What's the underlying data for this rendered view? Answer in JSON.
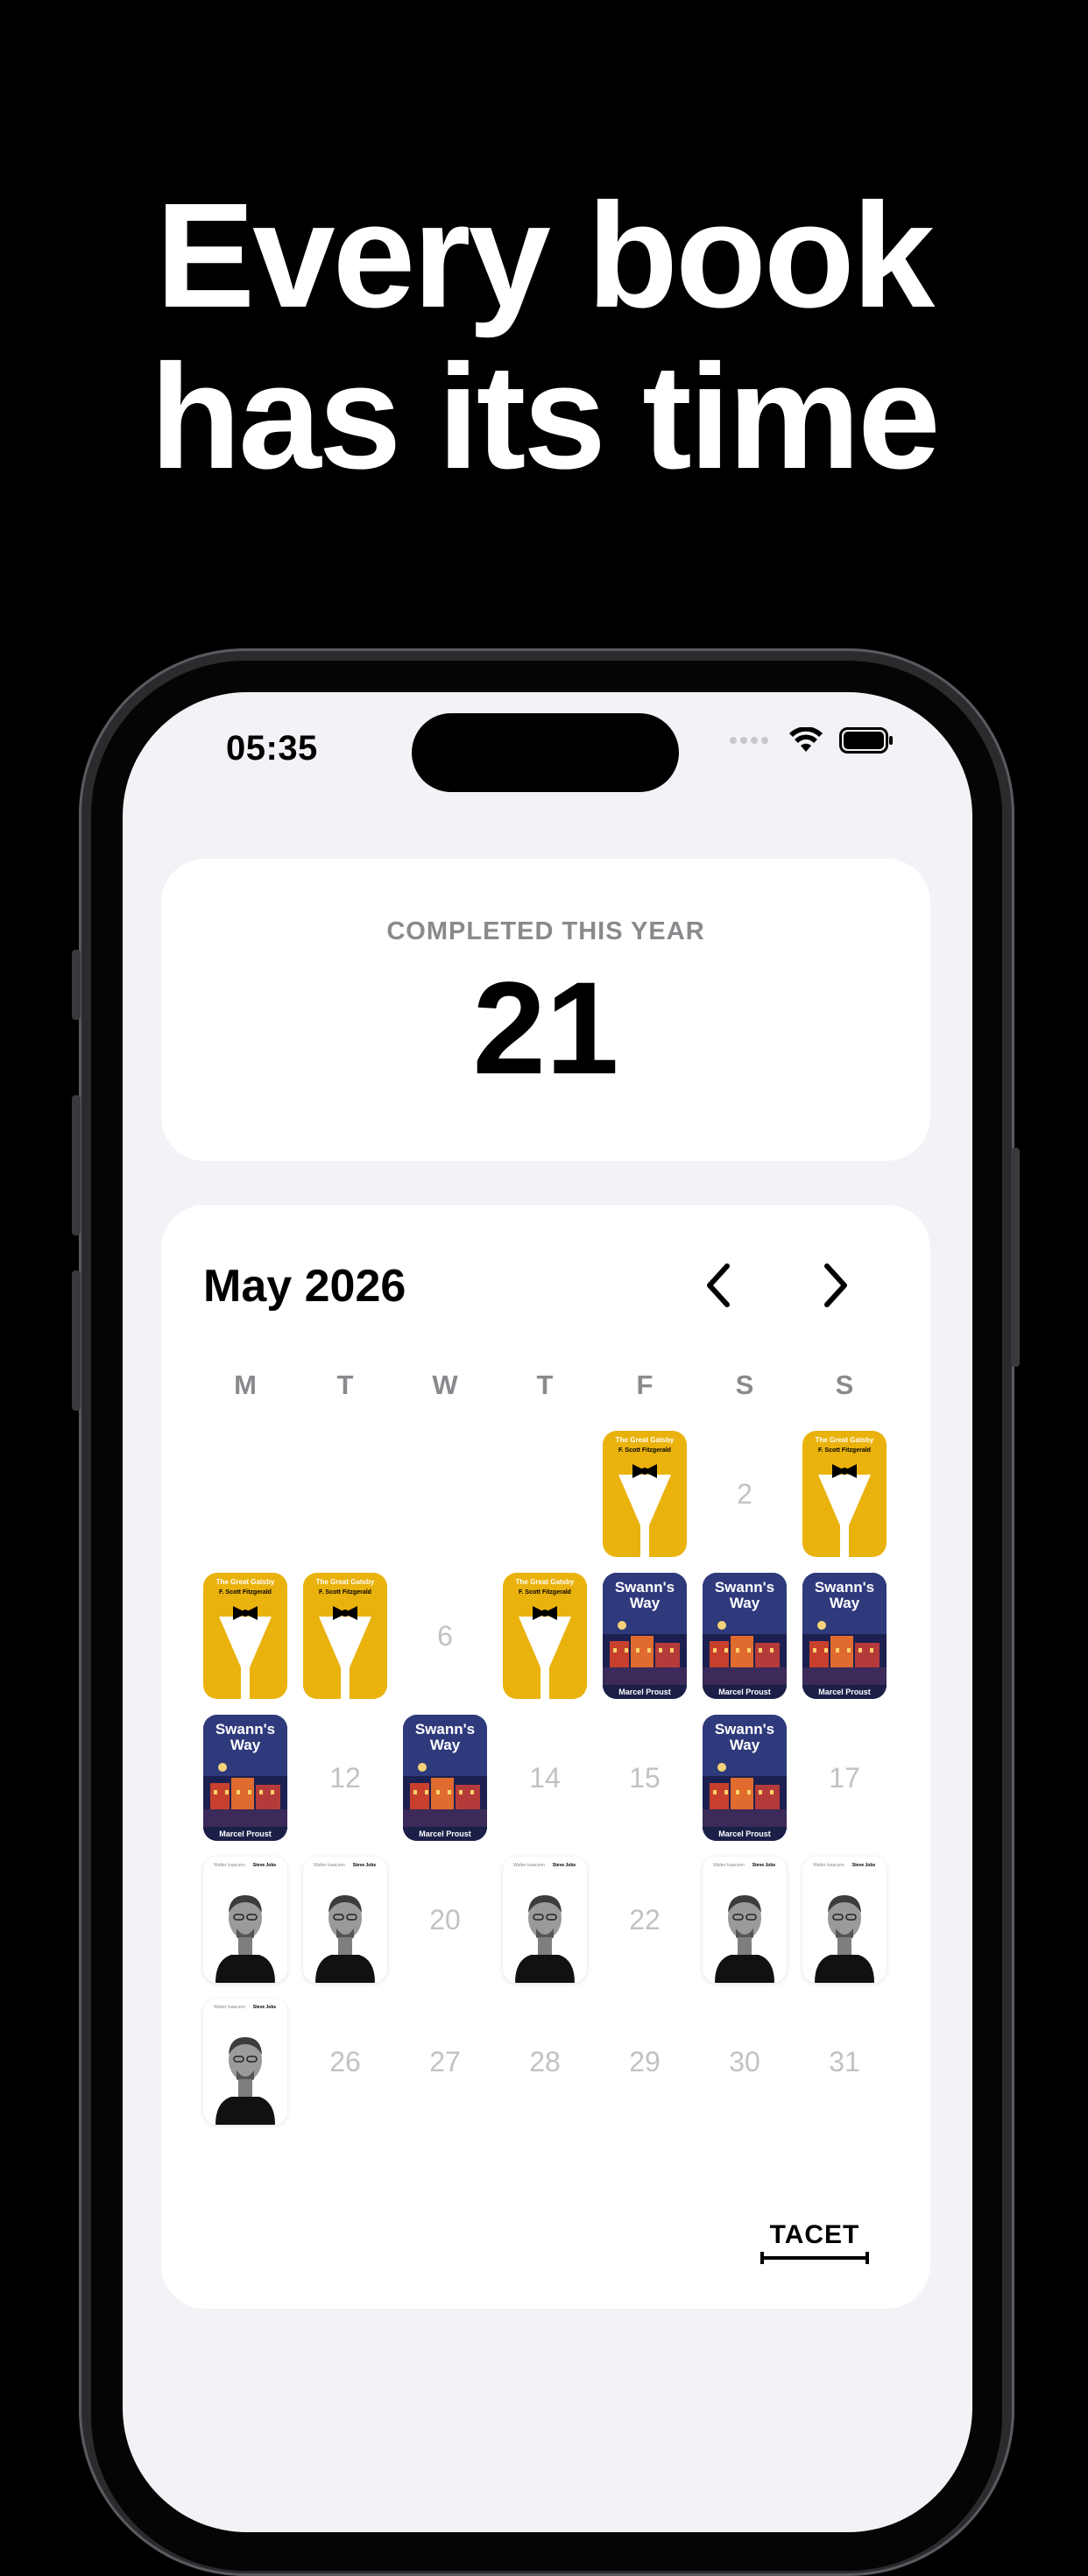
{
  "headline": {
    "line1": "Every book",
    "line2": "has its time"
  },
  "status_bar": {
    "time": "05:35"
  },
  "stats": {
    "label": "COMPLETED THIS YEAR",
    "value": "21"
  },
  "calendar": {
    "month_title": "May 2026",
    "prev_icon": "chevron-left-icon",
    "next_icon": "chevron-right-icon",
    "weekdays": [
      "M",
      "T",
      "W",
      "T",
      "F",
      "S",
      "S"
    ],
    "leading_blanks": 4,
    "days": [
      {
        "day": 1,
        "book": "gatsby"
      },
      {
        "day": 2,
        "book": null
      },
      {
        "day": 3,
        "book": "gatsby"
      },
      {
        "day": 4,
        "book": "gatsby"
      },
      {
        "day": 5,
        "book": "gatsby"
      },
      {
        "day": 6,
        "book": null
      },
      {
        "day": 7,
        "book": "gatsby"
      },
      {
        "day": 8,
        "book": "swann"
      },
      {
        "day": 9,
        "book": "swann"
      },
      {
        "day": 10,
        "book": "swann"
      },
      {
        "day": 11,
        "book": "swann"
      },
      {
        "day": 12,
        "book": null
      },
      {
        "day": 13,
        "book": "swann"
      },
      {
        "day": 14,
        "book": null
      },
      {
        "day": 15,
        "book": null
      },
      {
        "day": 16,
        "book": "swann"
      },
      {
        "day": 17,
        "book": null
      },
      {
        "day": 18,
        "book": "jobs"
      },
      {
        "day": 19,
        "book": "jobs"
      },
      {
        "day": 20,
        "book": null
      },
      {
        "day": 21,
        "book": "jobs"
      },
      {
        "day": 22,
        "book": null
      },
      {
        "day": 23,
        "book": "jobs"
      },
      {
        "day": 24,
        "book": "jobs"
      },
      {
        "day": 25,
        "book": "jobs"
      },
      {
        "day": 26,
        "book": null
      },
      {
        "day": 27,
        "book": null
      },
      {
        "day": 28,
        "book": null
      },
      {
        "day": 29,
        "book": null
      },
      {
        "day": 30,
        "book": null
      },
      {
        "day": 31,
        "book": null
      }
    ]
  },
  "books": {
    "gatsby": {
      "title": "The Great Gatsby",
      "author": "F. Scott Fitzgerald",
      "color": "#eab20d"
    },
    "swann": {
      "title_line1": "Swann's",
      "title_line2": "Way",
      "author": "Marcel Proust",
      "color": "#2e3470"
    },
    "jobs": {
      "author": "Walter Isaacson",
      "title": "Steve Jobs",
      "color": "#ffffff"
    }
  },
  "brand": {
    "name": "TACET"
  }
}
